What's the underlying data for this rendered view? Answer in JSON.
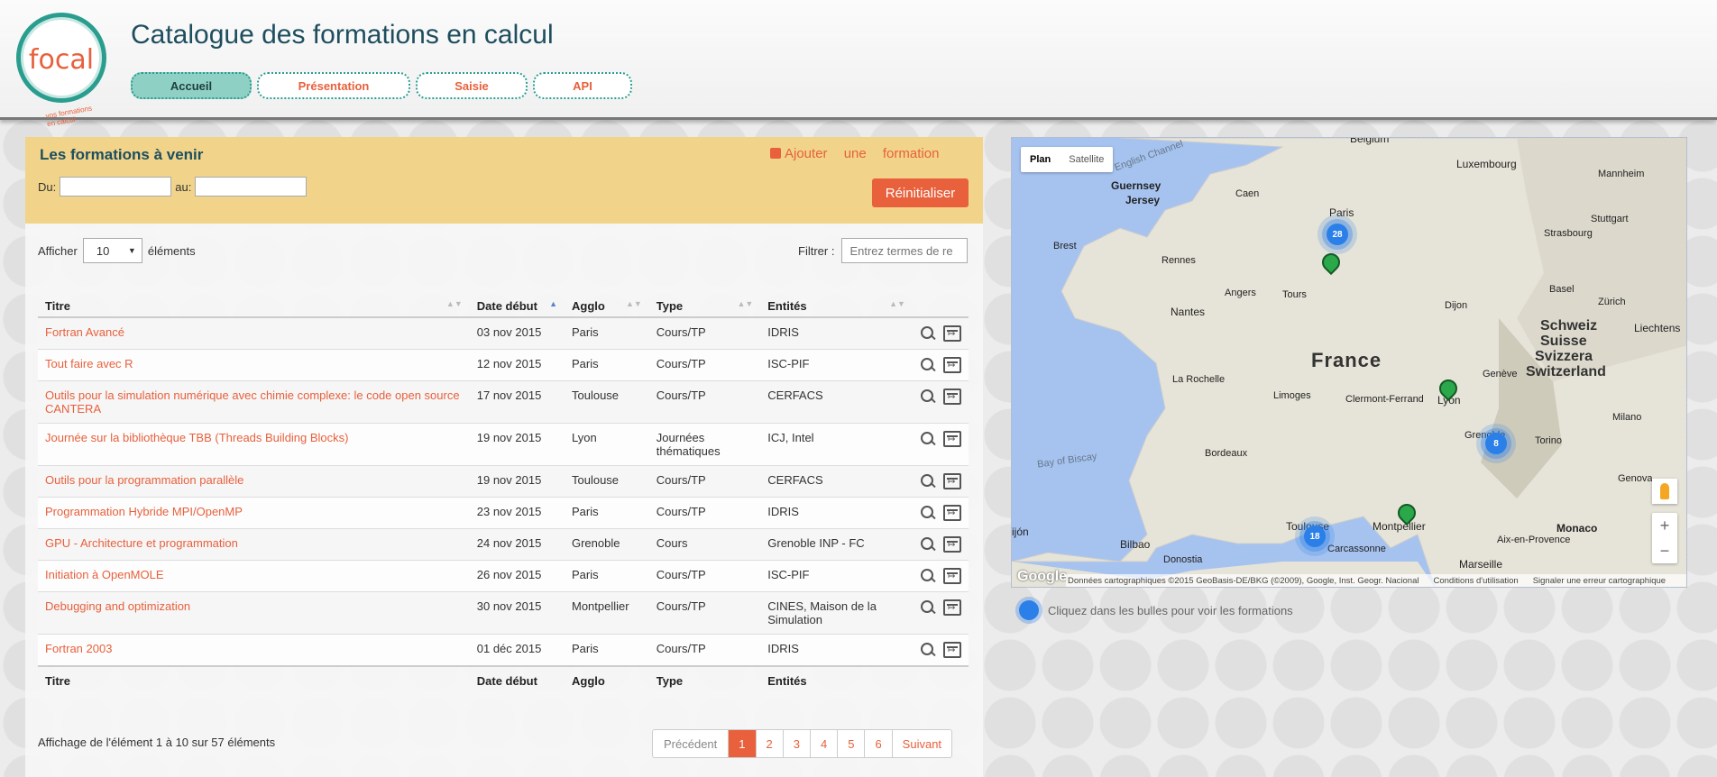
{
  "header": {
    "logo_text": "focal",
    "logo_sub": "vos formations en calcul",
    "title": "Catalogue des formations en calcul",
    "nav": [
      {
        "label": "Accueil"
      },
      {
        "label": "Présentation"
      },
      {
        "label": "Saisie"
      },
      {
        "label": "API"
      }
    ]
  },
  "upcoming": {
    "heading": "Les formations à venir",
    "add_label": "Ajouter une formation",
    "from_label": "Du:",
    "to_label": "au:",
    "reset_label": "Réinitialiser"
  },
  "list_controls": {
    "show_label": "Afficher",
    "show_value": "10",
    "elements_label": "éléments",
    "filter_label": "Filtrer :",
    "filter_placeholder": "Entrez termes de re"
  },
  "table": {
    "headers": {
      "title": "Titre",
      "date": "Date début",
      "agglo": "Agglo",
      "type": "Type",
      "entities": "Entités"
    },
    "rows": [
      {
        "title": "Fortran Avancé",
        "date": "03 nov 2015",
        "agglo": "Paris",
        "type": "Cours/TP",
        "entities": "IDRIS"
      },
      {
        "title": "Tout faire avec R",
        "date": "12 nov 2015",
        "agglo": "Paris",
        "type": "Cours/TP",
        "entities": "ISC-PIF"
      },
      {
        "title": "Outils pour la simulation numérique avec chimie complexe: le code open source CANTERA",
        "date": "17 nov 2015",
        "agglo": "Toulouse",
        "type": "Cours/TP",
        "entities": "CERFACS"
      },
      {
        "title": "Journée sur la bibliothèque TBB (Threads Building Blocks)",
        "date": "19 nov 2015",
        "agglo": "Lyon",
        "type": "Journées thématiques",
        "entities": "ICJ, Intel"
      },
      {
        "title": "Outils pour la programmation parallèle",
        "date": "19 nov 2015",
        "agglo": "Toulouse",
        "type": "Cours/TP",
        "entities": "CERFACS"
      },
      {
        "title": "Programmation Hybride MPI/OpenMP",
        "date": "23 nov 2015",
        "agglo": "Paris",
        "type": "Cours/TP",
        "entities": "IDRIS"
      },
      {
        "title": "GPU - Architecture et programmation",
        "date": "24 nov 2015",
        "agglo": "Grenoble",
        "type": "Cours",
        "entities": "Grenoble INP - FC"
      },
      {
        "title": "Initiation à OpenMOLE",
        "date": "26 nov 2015",
        "agglo": "Paris",
        "type": "Cours/TP",
        "entities": "ISC-PIF"
      },
      {
        "title": "Debugging and optimization",
        "date": "30 nov 2015",
        "agglo": "Montpellier",
        "type": "Cours/TP",
        "entities": "CINES, Maison de la Simulation"
      },
      {
        "title": "Fortran 2003",
        "date": "01 déc 2015",
        "agglo": "Paris",
        "type": "Cours/TP",
        "entities": "IDRIS"
      }
    ]
  },
  "pagination": {
    "info": "Affichage de l'élément 1 à 10 sur 57 éléments",
    "prev": "Précédent",
    "pages": [
      "1",
      "2",
      "3",
      "4",
      "5",
      "6"
    ],
    "current": "1",
    "next": "Suivant"
  },
  "map": {
    "toggle": [
      "Plan",
      "Satellite"
    ],
    "labels": {
      "english_channel": "English Channel",
      "belgium": "Belgium",
      "luxembourg": "Luxembourg",
      "mannheim": "Mannheim",
      "guernsey": "Guernsey",
      "jersey": "Jersey",
      "caen": "Caen",
      "paris": "Paris",
      "stuttgart": "Stuttgart",
      "strasbourg": "Strasbourg",
      "brest": "Brest",
      "rennes": "Rennes",
      "angers": "Angers",
      "tours": "Tours",
      "nantes": "Nantes",
      "dijon": "Dijon",
      "basel": "Basel",
      "zurich": "Zürich",
      "schweiz": "Schweiz",
      "suisse": "Suisse",
      "svizzera": "Svizzera",
      "switzerland": "Switzerland",
      "liechtenstein": "Liechtens",
      "france": "France",
      "la_rochelle": "La Rochelle",
      "limoges": "Limoges",
      "clermont": "Clermont-Ferrand",
      "lyon": "Lyon",
      "geneve": "Genève",
      "milano": "Milano",
      "grenoble": "Grenoble",
      "torino": "Torino",
      "bay_biscay": "Bay of Biscay",
      "bordeaux": "Bordeaux",
      "genova": "Genova",
      "toulouse": "Toulouse",
      "montpellier": "Montpellier",
      "monaco": "Monaco",
      "aix": "Aix-en-Provence",
      "gijon": "ijón",
      "bilbao": "Bilbao",
      "carcassonne": "Carcassonne",
      "marseille": "Marseille",
      "donostia": "Donostia"
    },
    "clusters": {
      "paris": "28",
      "grenoble": "8",
      "toulouse": "18"
    },
    "google": "Google",
    "attribution": "Données cartographiques ©2015 GeoBasis-DE/BKG (©2009), Google, Inst. Geogr. Nacional",
    "terms": "Conditions d'utilisation",
    "report": "Signaler une erreur cartographique",
    "hint": "Cliquez dans les bulles pour voir les formations"
  }
}
